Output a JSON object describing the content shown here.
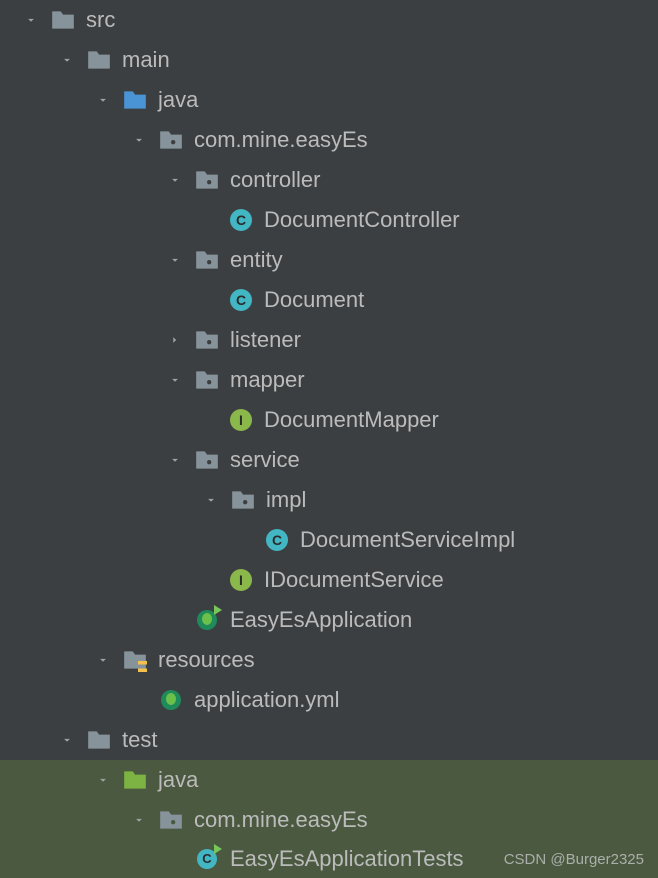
{
  "tree": {
    "src": "src",
    "main": "main",
    "java": "java",
    "pkg": "com.mine.easyEs",
    "controller": "controller",
    "DocumentController": "DocumentController",
    "entity": "entity",
    "Document": "Document",
    "listener": "listener",
    "mapper": "mapper",
    "DocumentMapper": "DocumentMapper",
    "service": "service",
    "impl": "impl",
    "DocumentServiceImpl": "DocumentServiceImpl",
    "IDocumentService": "IDocumentService",
    "EasyEsApplication": "EasyEsApplication",
    "resources": "resources",
    "application_yml": "application.yml",
    "test": "test",
    "test_java": "java",
    "test_pkg": "com.mine.easyEs",
    "EasyEsApplicationTests": "EasyEsApplicationTests"
  },
  "watermark": "CSDN @Burger2325"
}
